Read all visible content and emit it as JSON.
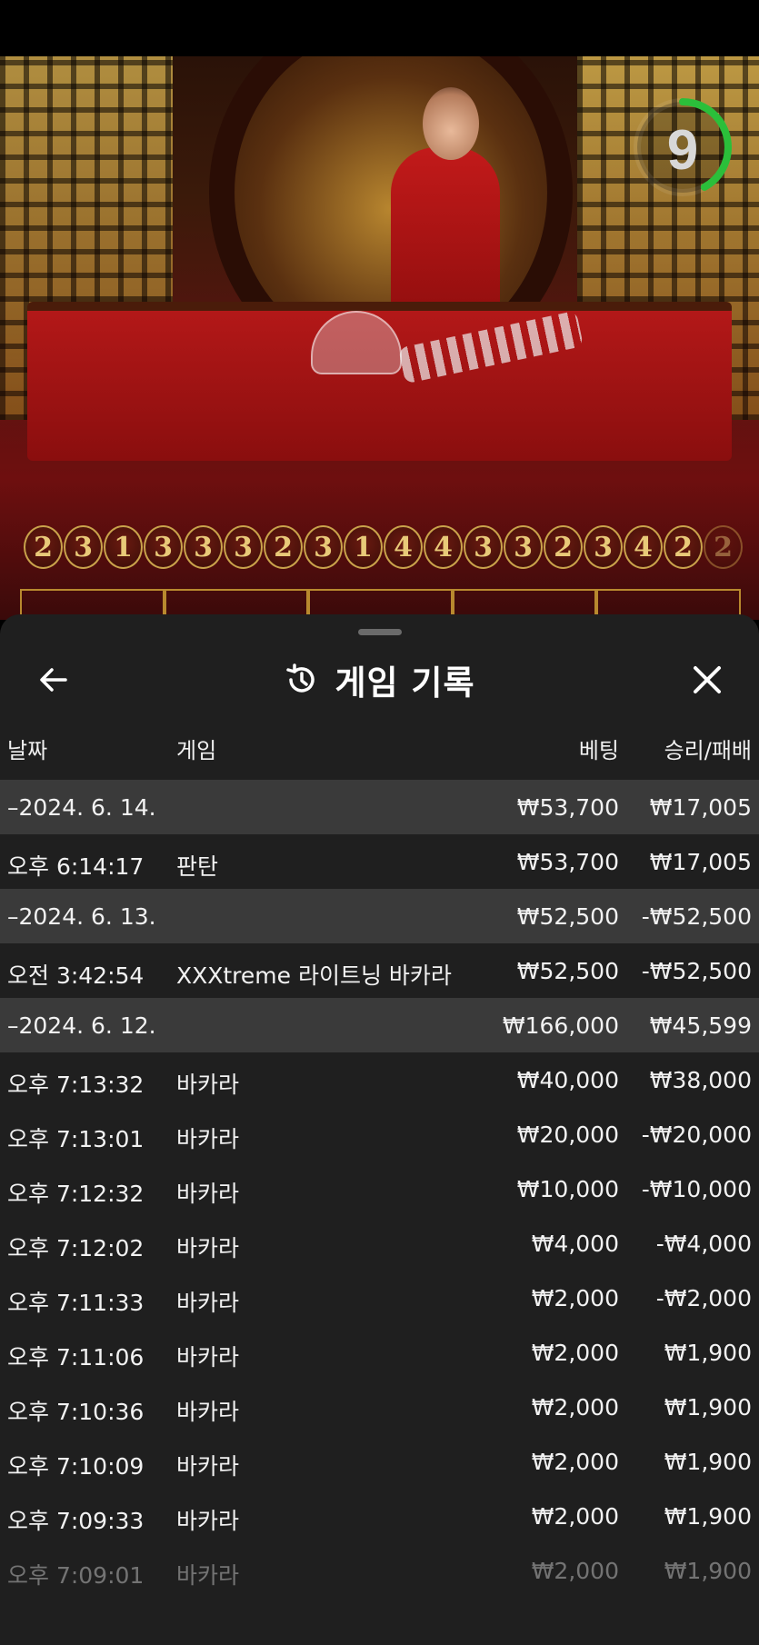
{
  "timer": {
    "value": "9",
    "progress": 0.42,
    "color": "#2bbf3a"
  },
  "results": [
    "2",
    "3",
    "1",
    "3",
    "3",
    "3",
    "2",
    "3",
    "1",
    "4",
    "4",
    "3",
    "3",
    "2",
    "3",
    "4",
    "2",
    "2"
  ],
  "sheet": {
    "title": "게임 기록",
    "back_icon": "arrow-left-icon",
    "history_icon": "history-icon",
    "close_icon": "close-icon"
  },
  "columns": {
    "date": "날짜",
    "game": "게임",
    "bet": "베팅",
    "win": "승리/패배"
  },
  "rows": [
    {
      "type": "date",
      "date": "–2024. 6. 14.",
      "game": "",
      "bet": "₩53,700",
      "win": "₩17,005"
    },
    {
      "type": "entry",
      "date": "오후 6:14:17",
      "game": "판탄",
      "bet": "₩53,700",
      "win": "₩17,005"
    },
    {
      "type": "date",
      "date": "–2024. 6. 13.",
      "game": "",
      "bet": "₩52,500",
      "win": "-₩52,500"
    },
    {
      "type": "entry",
      "date": "오전 3:42:54",
      "game": "XXXtreme 라이트닝 바카라",
      "bet": "₩52,500",
      "win": "-₩52,500"
    },
    {
      "type": "date",
      "date": "–2024. 6. 12.",
      "game": "",
      "bet": "₩166,000",
      "win": "₩45,599"
    },
    {
      "type": "entry",
      "date": "오후 7:13:32",
      "game": "바카라",
      "bet": "₩40,000",
      "win": "₩38,000"
    },
    {
      "type": "entry",
      "date": "오후 7:13:01",
      "game": "바카라",
      "bet": "₩20,000",
      "win": "-₩20,000"
    },
    {
      "type": "entry",
      "date": "오후 7:12:32",
      "game": "바카라",
      "bet": "₩10,000",
      "win": "-₩10,000"
    },
    {
      "type": "entry",
      "date": "오후 7:12:02",
      "game": "바카라",
      "bet": "₩4,000",
      "win": "-₩4,000"
    },
    {
      "type": "entry",
      "date": "오후 7:11:33",
      "game": "바카라",
      "bet": "₩2,000",
      "win": "-₩2,000"
    },
    {
      "type": "entry",
      "date": "오후 7:11:06",
      "game": "바카라",
      "bet": "₩2,000",
      "win": "₩1,900"
    },
    {
      "type": "entry",
      "date": "오후 7:10:36",
      "game": "바카라",
      "bet": "₩2,000",
      "win": "₩1,900"
    },
    {
      "type": "entry",
      "date": "오후 7:10:09",
      "game": "바카라",
      "bet": "₩2,000",
      "win": "₩1,900"
    },
    {
      "type": "entry",
      "date": "오후 7:09:33",
      "game": "바카라",
      "bet": "₩2,000",
      "win": "₩1,900"
    },
    {
      "type": "entry",
      "date": "오후 7:09:01",
      "game": "바카라",
      "bet": "₩2,000",
      "win": "₩1,900",
      "faded": true
    }
  ]
}
